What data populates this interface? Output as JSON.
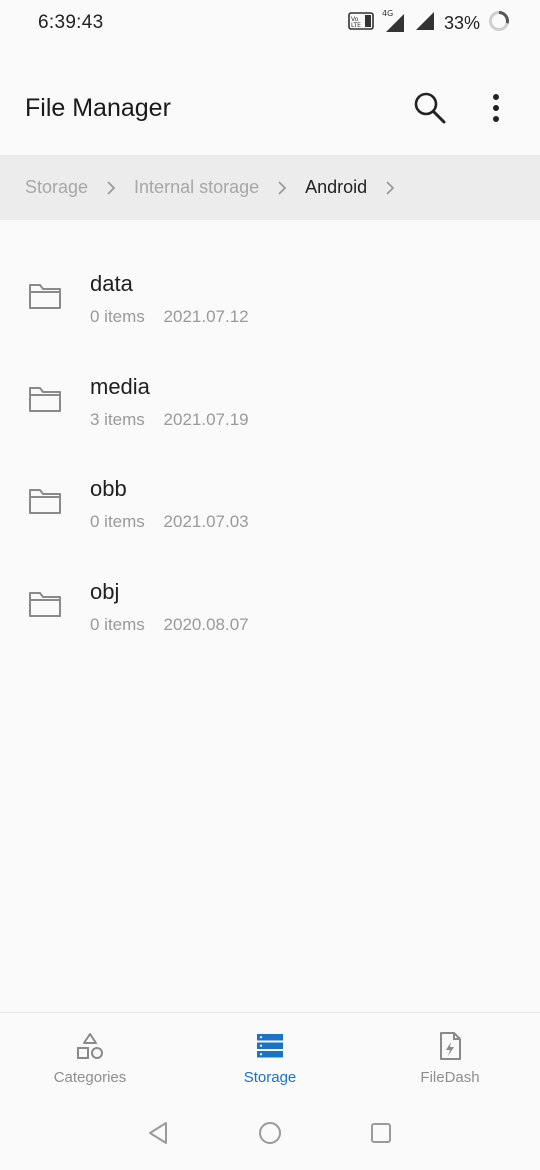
{
  "status_bar": {
    "time": "6:39:43",
    "network": "4G",
    "battery": "33%"
  },
  "app_bar": {
    "title": "File Manager",
    "search_icon": "search-icon",
    "more_icon": "more-vert-icon"
  },
  "breadcrumb": {
    "items": [
      "Storage",
      "Internal storage",
      "Android"
    ]
  },
  "folders": [
    {
      "name": "data",
      "items": "0 items",
      "date": "2021.07.12"
    },
    {
      "name": "media",
      "items": "3 items",
      "date": "2021.07.19"
    },
    {
      "name": "obb",
      "items": "0 items",
      "date": "2021.07.03"
    },
    {
      "name": "obj",
      "items": "0 items",
      "date": "2020.08.07"
    }
  ],
  "bottom_nav": {
    "items": [
      {
        "label": "Categories",
        "icon": "categories-icon"
      },
      {
        "label": "Storage",
        "icon": "storage-icon",
        "active": true
      },
      {
        "label": "FileDash",
        "icon": "filedash-icon"
      }
    ]
  },
  "colors": {
    "accent": "#1a73c7",
    "breadcrumb_bg": "#ececec",
    "background": "#fafafa"
  }
}
